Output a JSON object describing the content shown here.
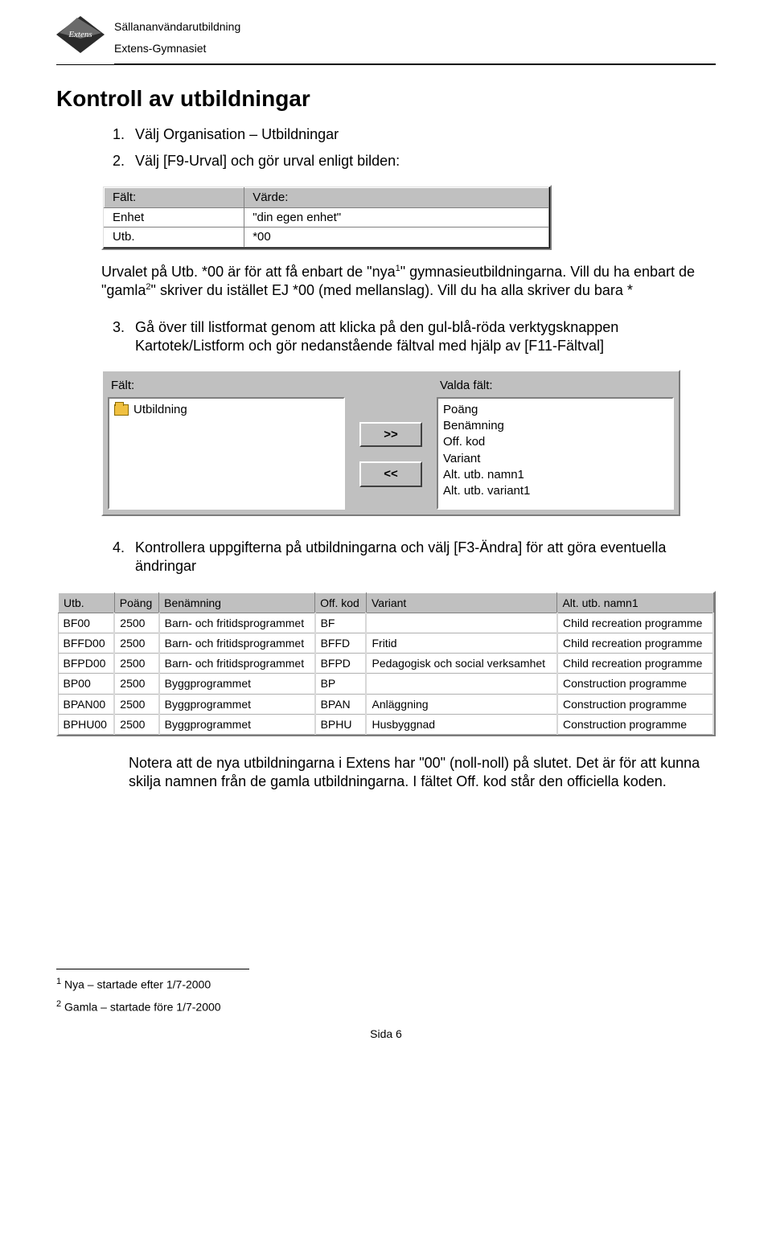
{
  "header": {
    "line1": "Sällananvändarutbildning",
    "line2": "Extens-Gymnasiet",
    "logo_text": "Extens"
  },
  "title": "Kontroll av utbildningar",
  "list1": [
    "Välj Organisation – Utbildningar",
    "Välj [F9-Urval] och gör urval enligt bilden:"
  ],
  "table1": {
    "headers": [
      "Fält:",
      "Värde:"
    ],
    "rows": [
      [
        "Enhet",
        "\"din egen enhet\""
      ],
      [
        "Utb.",
        "*00"
      ]
    ]
  },
  "para1_a": "Urvalet på Utb. *00 är för att få enbart de \"nya",
  "para1_sup1": "1",
  "para1_b": "\" gymnasieutbildningarna. Vill du ha enbart de \"gamla",
  "para1_sup2": "2",
  "para1_c": "\" skriver du istället EJ *00 (med mellanslag). Vill du ha alla skriver du bara *",
  "list3": [
    "Gå över till listformat genom att klicka på den gul-blå-röda verktygsknappen Kartotek/Listform och gör nedanstående fältval med hjälp av [F11-Fältval]"
  ],
  "fsel": {
    "left_label": "Fält:",
    "right_label": "Valda fält:",
    "left_items": [
      "Utbildning"
    ],
    "btn_add": ">>",
    "btn_remove": "<<",
    "right_items": [
      "Poäng",
      "Benämning",
      "Off. kod",
      "Variant",
      "Alt. utb. namn1",
      "Alt. utb. variant1"
    ]
  },
  "list4": [
    "Kontrollera uppgifterna på utbildningarna och välj [F3-Ändra] för att göra eventuella ändringar"
  ],
  "grid": {
    "headers": [
      "Utb.",
      "Poäng",
      "Benämning",
      "Off. kod",
      "Variant",
      "Alt. utb. namn1"
    ],
    "rows": [
      [
        "BF00",
        "2500",
        "Barn- och fritidsprogrammet",
        "BF",
        "",
        "Child recreation programme"
      ],
      [
        "BFFD00",
        "2500",
        "Barn- och fritidsprogrammet",
        "BFFD",
        "Fritid",
        "Child recreation programme"
      ],
      [
        "BFPD00",
        "2500",
        "Barn- och fritidsprogrammet",
        "BFPD",
        "Pedagogisk och social verksamhet",
        "Child recreation programme"
      ],
      [
        "BP00",
        "2500",
        "Byggprogrammet",
        "BP",
        "",
        "Construction programme"
      ],
      [
        "BPAN00",
        "2500",
        "Byggprogrammet",
        "BPAN",
        "Anläggning",
        "Construction programme"
      ],
      [
        "BPHU00",
        "2500",
        "Byggprogrammet",
        "BPHU",
        "Husbyggnad",
        "Construction programme"
      ]
    ]
  },
  "para2": "Notera att de nya utbildningarna i Extens har \"00\" (noll-noll) på slutet. Det är för att kunna skilja namnen från de gamla utbildningarna. I fältet Off. kod står  den officiella koden.",
  "footnotes": {
    "fn1_sup": "1",
    "fn1": " Nya – startade efter 1/7-2000",
    "fn2_sup": "2",
    "fn2": " Gamla – startade före 1/7-2000"
  },
  "footer": "Sida 6"
}
